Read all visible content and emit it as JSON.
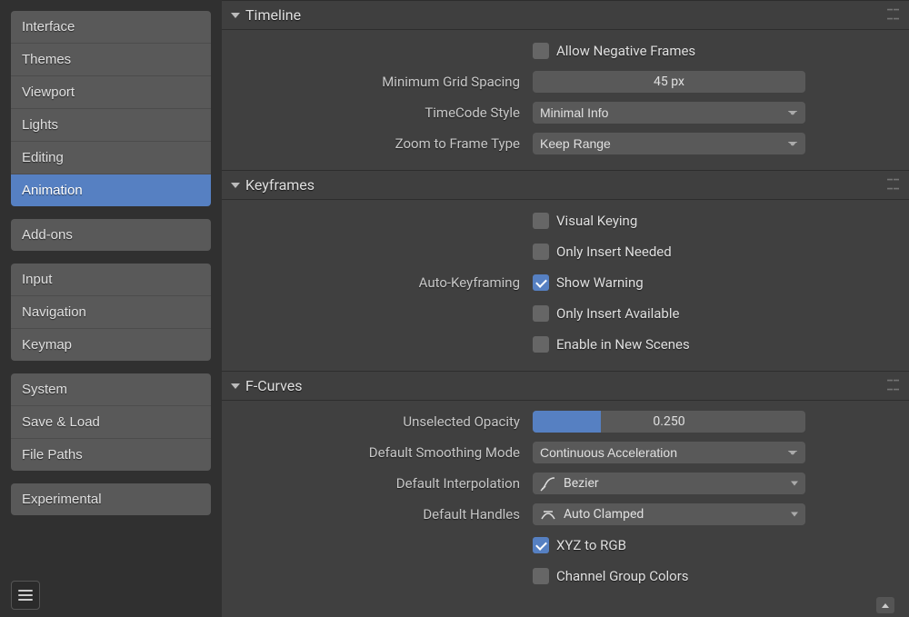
{
  "sidebar": {
    "groups": [
      [
        "Interface",
        "Themes",
        "Viewport",
        "Lights",
        "Editing",
        "Animation"
      ],
      [
        "Add-ons"
      ],
      [
        "Input",
        "Navigation",
        "Keymap"
      ],
      [
        "System",
        "Save & Load",
        "File Paths"
      ],
      [
        "Experimental"
      ]
    ],
    "active": "Animation"
  },
  "timeline": {
    "title": "Timeline",
    "allow_negative_frames": {
      "label": "Allow Negative Frames",
      "checked": false
    },
    "min_grid_spacing": {
      "label": "Minimum Grid Spacing",
      "value": "45 px"
    },
    "timecode_style": {
      "label": "TimeCode Style",
      "value": "Minimal Info"
    },
    "zoom_to_frame_type": {
      "label": "Zoom to Frame Type",
      "value": "Keep Range"
    }
  },
  "keyframes": {
    "title": "Keyframes",
    "visual_keying": {
      "label": "Visual Keying",
      "checked": false
    },
    "only_insert_needed": {
      "label": "Only Insert Needed",
      "checked": false
    },
    "auto_keyframing_label": "Auto-Keyframing",
    "show_warning": {
      "label": "Show Warning",
      "checked": true
    },
    "only_insert_available": {
      "label": "Only Insert Available",
      "checked": false
    },
    "enable_in_new_scenes": {
      "label": "Enable in New Scenes",
      "checked": false
    }
  },
  "fcurves": {
    "title": "F-Curves",
    "unselected_opacity": {
      "label": "Unselected Opacity",
      "value": "0.250",
      "fill_percent": 25
    },
    "default_smoothing": {
      "label": "Default Smoothing Mode",
      "value": "Continuous Acceleration"
    },
    "default_interpolation": {
      "label": "Default Interpolation",
      "value": "Bezier"
    },
    "default_handles": {
      "label": "Default Handles",
      "value": "Auto Clamped"
    },
    "xyz_to_rgb": {
      "label": "XYZ to RGB",
      "checked": true
    },
    "channel_group_colors": {
      "label": "Channel Group Colors",
      "checked": false
    }
  }
}
